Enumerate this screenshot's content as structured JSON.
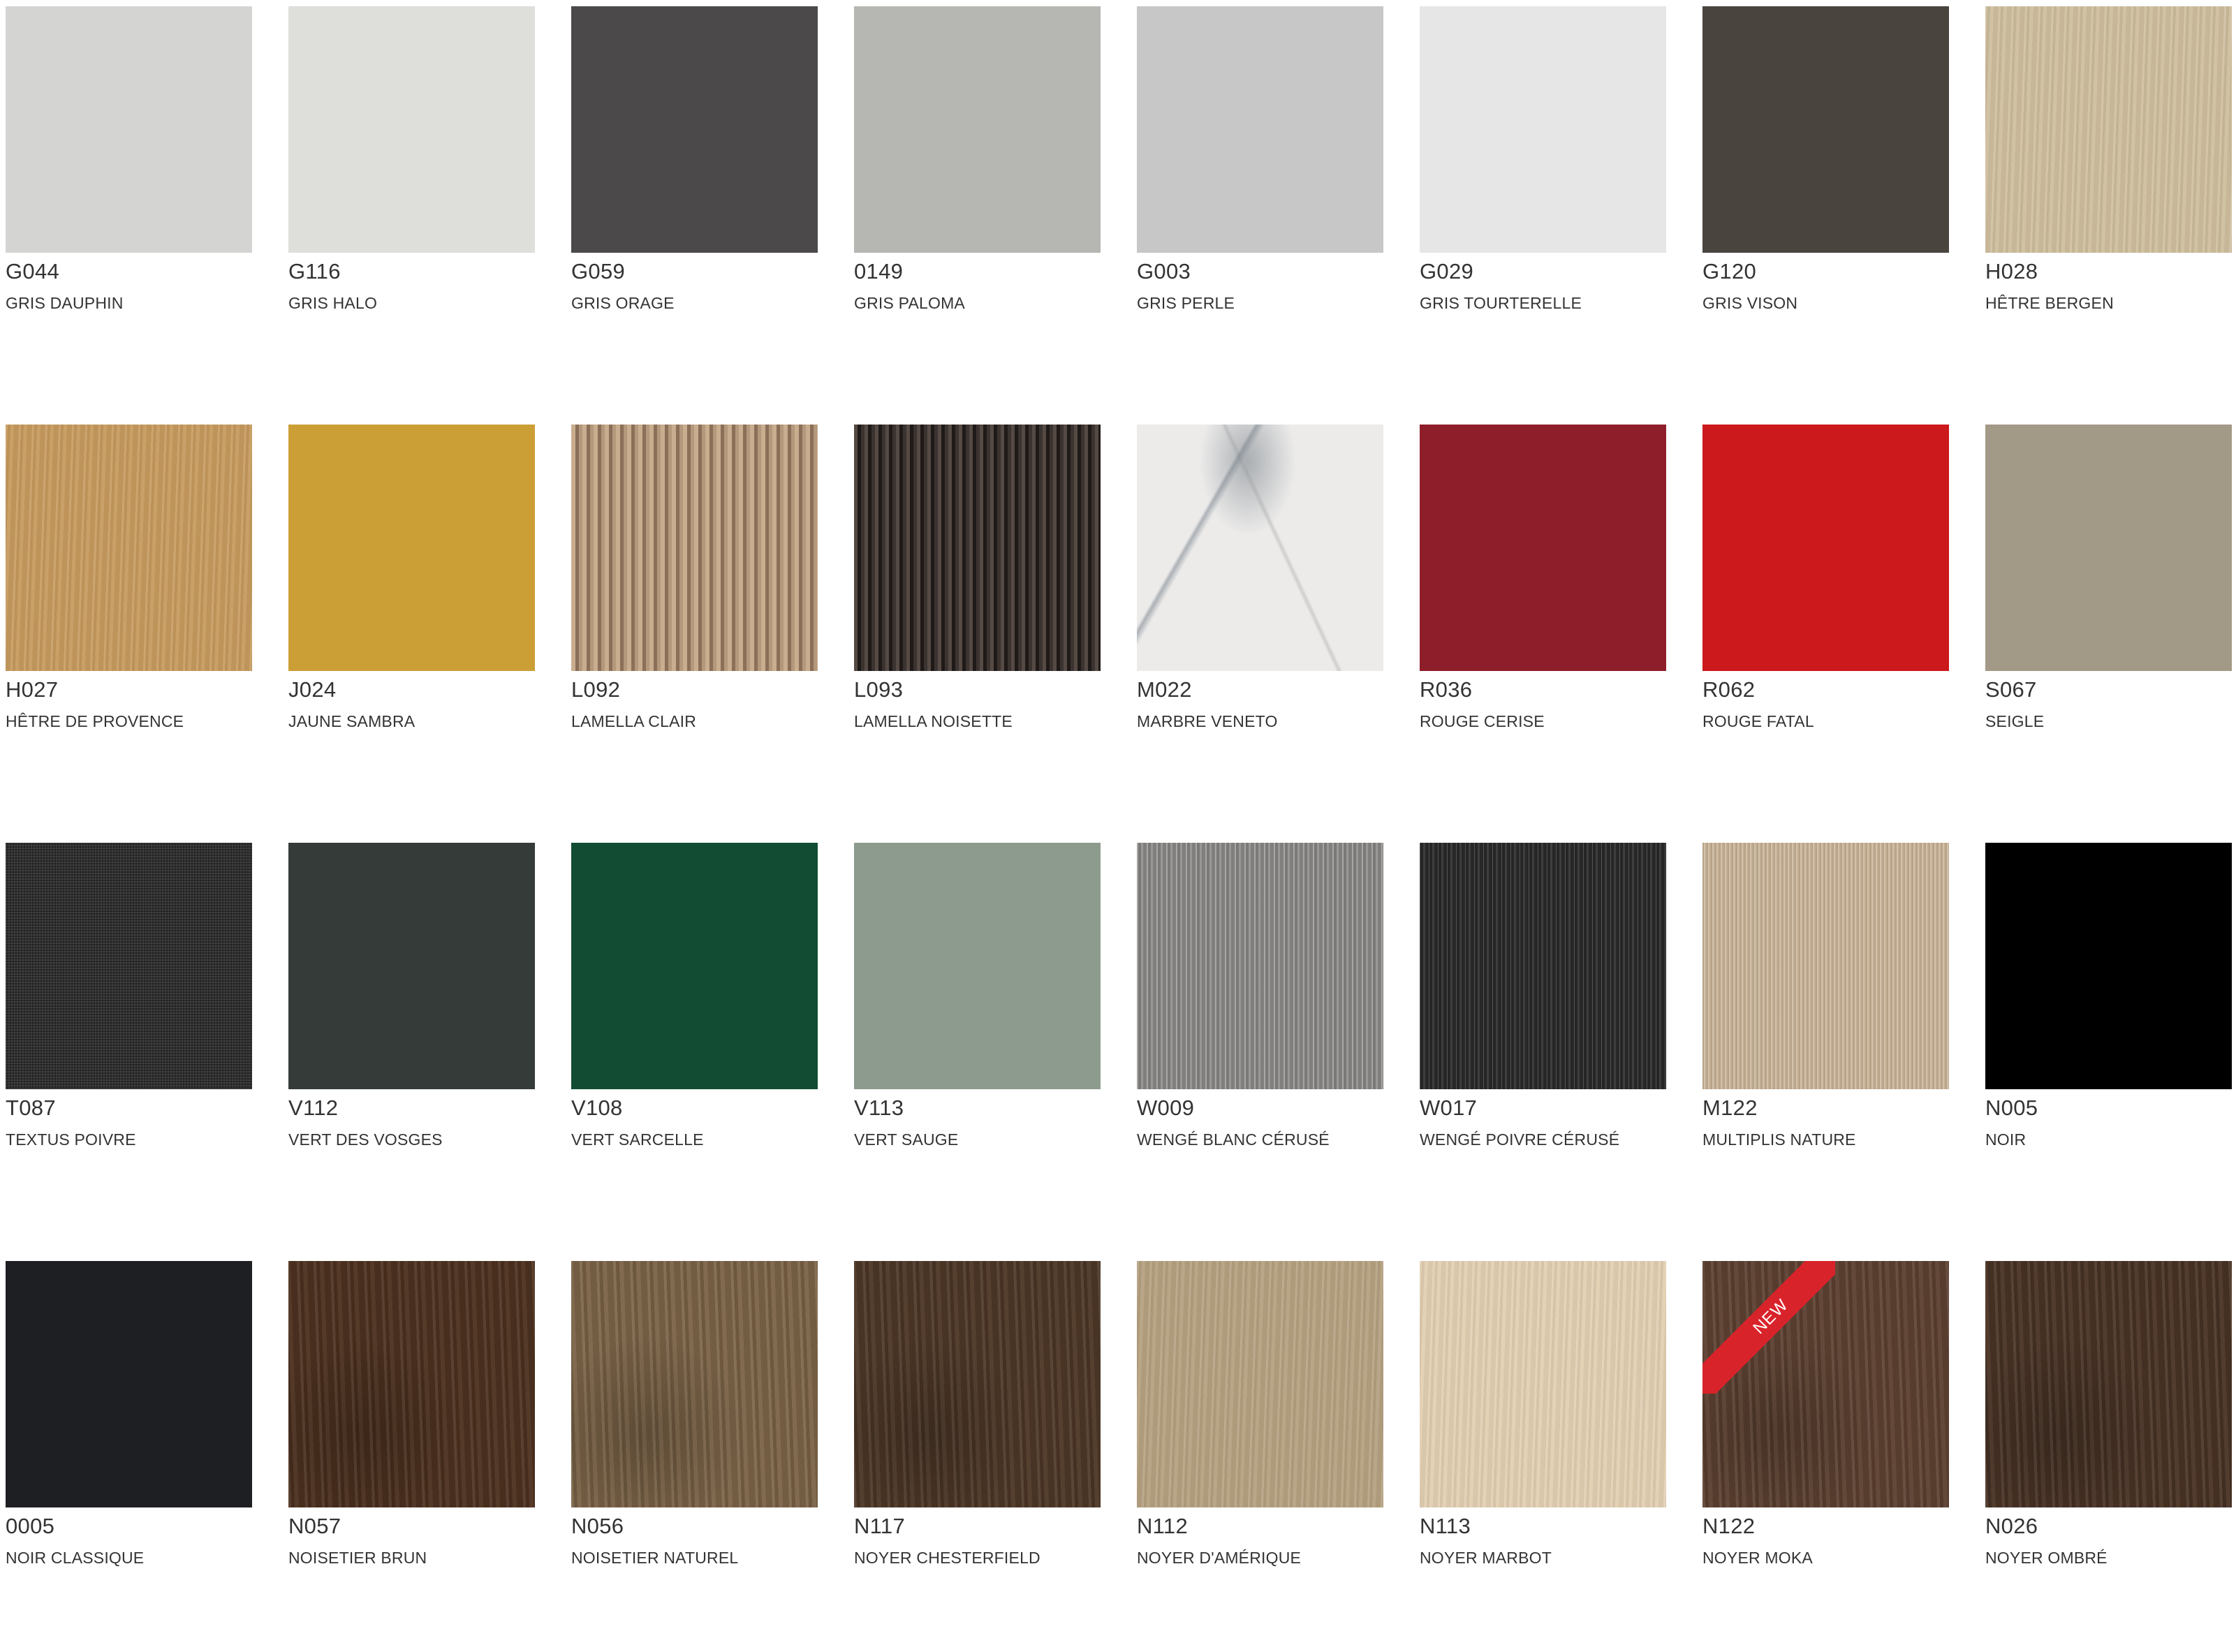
{
  "swatches": [
    {
      "code": "G044",
      "name": "GRIS DAUPHIN",
      "color": "#d4d4d2",
      "texture": "plain"
    },
    {
      "code": "G116",
      "name": "GRIS HALO",
      "color": "#dedfdb",
      "texture": "plain"
    },
    {
      "code": "G059",
      "name": "GRIS ORAGE",
      "color": "#4b494a",
      "texture": "plain"
    },
    {
      "code": "0149",
      "name": "GRIS PALOMA",
      "color": "#b6b7b2",
      "texture": "plain"
    },
    {
      "code": "G003",
      "name": "GRIS PERLE",
      "color": "#c7c7c8",
      "texture": "plain"
    },
    {
      "code": "G029",
      "name": "GRIS TOURTERELLE",
      "color": "#e6e6e7",
      "texture": "plain"
    },
    {
      "code": "G120",
      "name": "GRIS VISON",
      "color": "#4a443e",
      "texture": "plain"
    },
    {
      "code": "H028",
      "name": "HÊTRE BERGEN",
      "color": "#cfbe9e",
      "texture": "wood-light"
    },
    {
      "code": "H027",
      "name": "HÊTRE DE PROVENCE",
      "color": "#c69a5e",
      "texture": "wood-light"
    },
    {
      "code": "J024",
      "name": "JAUNE SAMBRA",
      "color": "#cc9f36",
      "texture": "plain"
    },
    {
      "code": "L092",
      "name": "LAMELLA CLAIR",
      "color": "#a68a70",
      "texture": "lamella-light"
    },
    {
      "code": "L093",
      "name": "LAMELLA NOISETTE",
      "color": "#3a3330",
      "texture": "lamella-dark"
    },
    {
      "code": "M022",
      "name": "MARBRE VENETO",
      "color": "#ecebea",
      "texture": "marble"
    },
    {
      "code": "R036",
      "name": "ROUGE CERISE",
      "color": "#8f1e2b",
      "texture": "plain"
    },
    {
      "code": "R062",
      "name": "ROUGE FATAL",
      "color": "#cc191c",
      "texture": "plain"
    },
    {
      "code": "S067",
      "name": "SEIGLE",
      "color": "#a39987",
      "texture": "plain"
    },
    {
      "code": "T087",
      "name": "TEXTUS POIVRE",
      "color": "#2c2c2c",
      "texture": "linen"
    },
    {
      "code": "V112",
      "name": "VERT DES VOSGES",
      "color": "#353b39",
      "texture": "plain"
    },
    {
      "code": "V108",
      "name": "VERT SARCELLE",
      "color": "#124d33",
      "texture": "plain"
    },
    {
      "code": "V113",
      "name": "VERT SAUGE",
      "color": "#8c9b8d",
      "texture": "plain"
    },
    {
      "code": "W009",
      "name": "WENGÉ BLANC CÉRUSÉ",
      "color": "#8c8a88",
      "texture": "cerused-light"
    },
    {
      "code": "W017",
      "name": "WENGÉ POIVRE CÉRUSÉ",
      "color": "#2e2e2e",
      "texture": "cerused-dark"
    },
    {
      "code": "M122",
      "name": "MULTIPLIS NATURE",
      "color": "#cbb89d",
      "texture": "fine-stripes"
    },
    {
      "code": "N005",
      "name": "NOIR",
      "color": "#000000",
      "texture": "plain"
    },
    {
      "code": "0005",
      "name": "NOIR CLASSIQUE",
      "color": "#1e1f22",
      "texture": "plain"
    },
    {
      "code": "N057",
      "name": "NOISETIER BRUN",
      "color": "#4e3220",
      "texture": "wood-dark"
    },
    {
      "code": "N056",
      "name": "NOISETIER NATUREL",
      "color": "#7c6448",
      "texture": "wood-dark"
    },
    {
      "code": "N117",
      "name": "NOYER CHESTERFIELD",
      "color": "#4e3828",
      "texture": "wood-dark"
    },
    {
      "code": "N112",
      "name": "NOYER D'AMÉRIQUE",
      "color": "#b5a181",
      "texture": "wood-light"
    },
    {
      "code": "N113",
      "name": "NOYER MARBOT",
      "color": "#e2cfb2",
      "texture": "wood-light"
    },
    {
      "code": "N122",
      "name": "NOYER MOKA",
      "color": "#5e4232",
      "texture": "wood-dark",
      "badge": "NEW"
    },
    {
      "code": "N026",
      "name": "NOYER OMBRÉ",
      "color": "#4a3426",
      "texture": "wood-dark"
    }
  ],
  "badge_color": "#d8232a"
}
